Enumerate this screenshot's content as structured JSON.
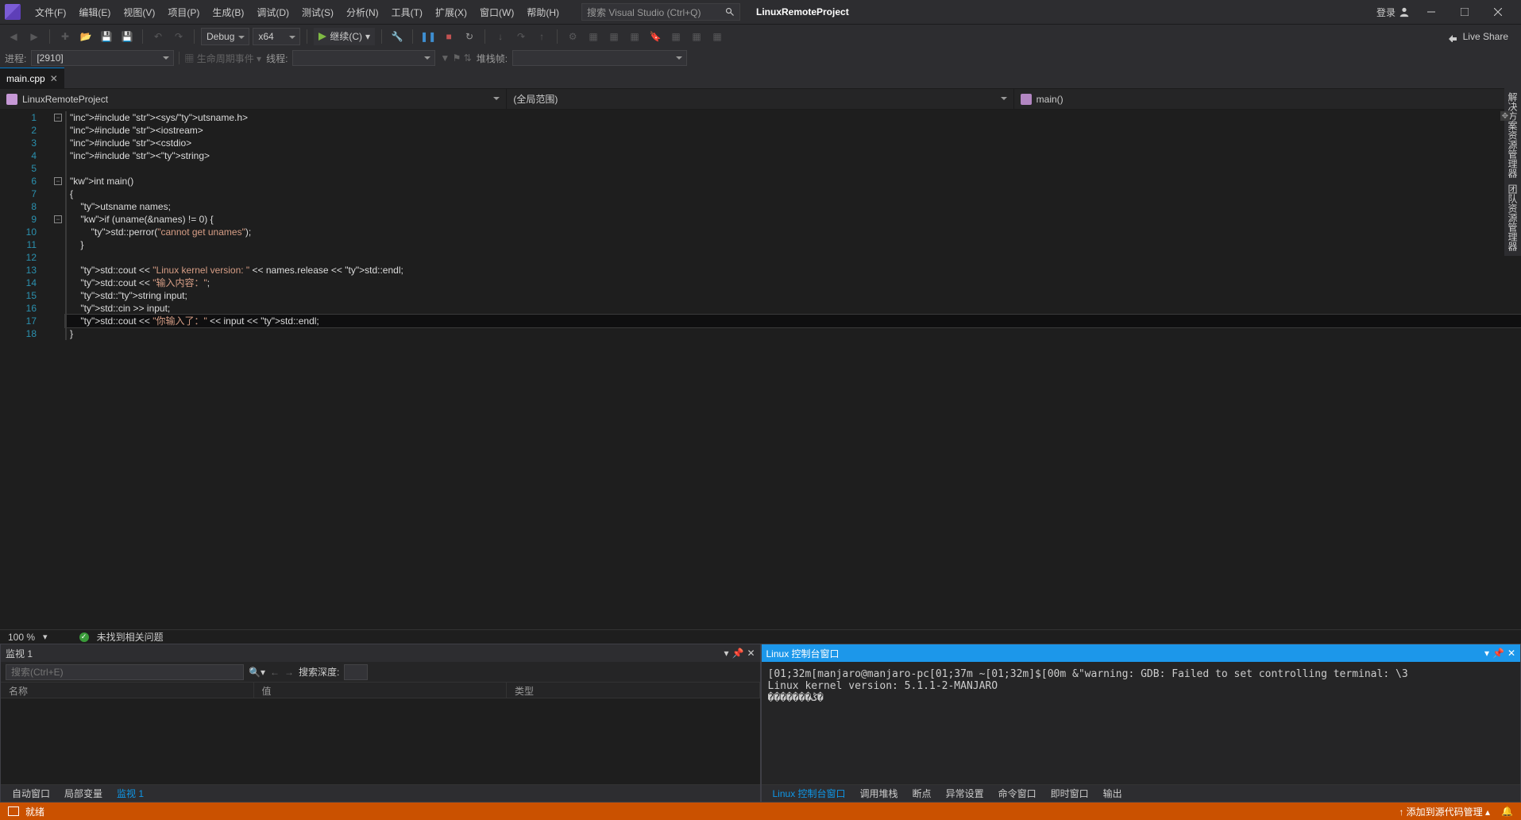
{
  "title": "LinuxRemoteProject",
  "login": "登录",
  "menus": [
    "文件(F)",
    "编辑(E)",
    "视图(V)",
    "项目(P)",
    "生成(B)",
    "调试(D)",
    "测试(S)",
    "分析(N)",
    "工具(T)",
    "扩展(X)",
    "窗口(W)",
    "帮助(H)"
  ],
  "search_placeholder": "搜索 Visual Studio (Ctrl+Q)",
  "liveshare": "Live Share",
  "toolbar": {
    "config": "Debug",
    "platform": "x64",
    "continue": "继续(C)"
  },
  "dbg": {
    "proc_label": "进程:",
    "proc_val": "[2910]",
    "life": "生命周期事件",
    "thread": "线程:",
    "stack": "堆栈帧:"
  },
  "tab": "main.cpp",
  "nav": {
    "project": "LinuxRemoteProject",
    "scope": "(全局范围)",
    "func": "main()"
  },
  "zoom": "100 %",
  "status_ok": "未找到相关问题",
  "code_lines": [
    "#include <sys/utsname.h>",
    "#include <iostream>",
    "#include <cstdio>",
    "#include <string>",
    "",
    "int main()",
    "{",
    "    utsname names;",
    "    if (uname(&names) != 0) {",
    "        std::perror(\"cannot get unames\");",
    "    }",
    "",
    "    std::cout << \"Linux kernel version: \" << names.release << std::endl;",
    "    std::cout << \"输入内容：\";",
    "    std::string input;",
    "    std::cin >> input;",
    "    std::cout << \"你输入了：\" << input << std::endl;",
    "}"
  ],
  "watch": {
    "title": "监视 1",
    "search_ph": "搜索(Ctrl+E)",
    "depth": "搜索深度:",
    "cols": [
      "名称",
      "值",
      "类型"
    ],
    "tabs": [
      "自动窗口",
      "局部变量",
      "监视 1"
    ]
  },
  "console": {
    "title": "Linux 控制台窗口",
    "lines": [
      "[01;32m[manjaro@manjaro-pc[01;37m ~[01;32m]$[00m &\"warning: GDB: Failed to set controlling terminal: \\3",
      "Linux kernel version: 5.1.1-2-MANJARO",
      "�������ݣ�"
    ],
    "tabs": [
      "Linux 控制台窗口",
      "调用堆栈",
      "断点",
      "异常设置",
      "命令窗口",
      "即时窗口",
      "输出"
    ]
  },
  "statusbar": {
    "ready": "就绪",
    "scm": "添加到源代码管理"
  },
  "side": [
    "解决方案资源管理器",
    "团队资源管理器"
  ]
}
